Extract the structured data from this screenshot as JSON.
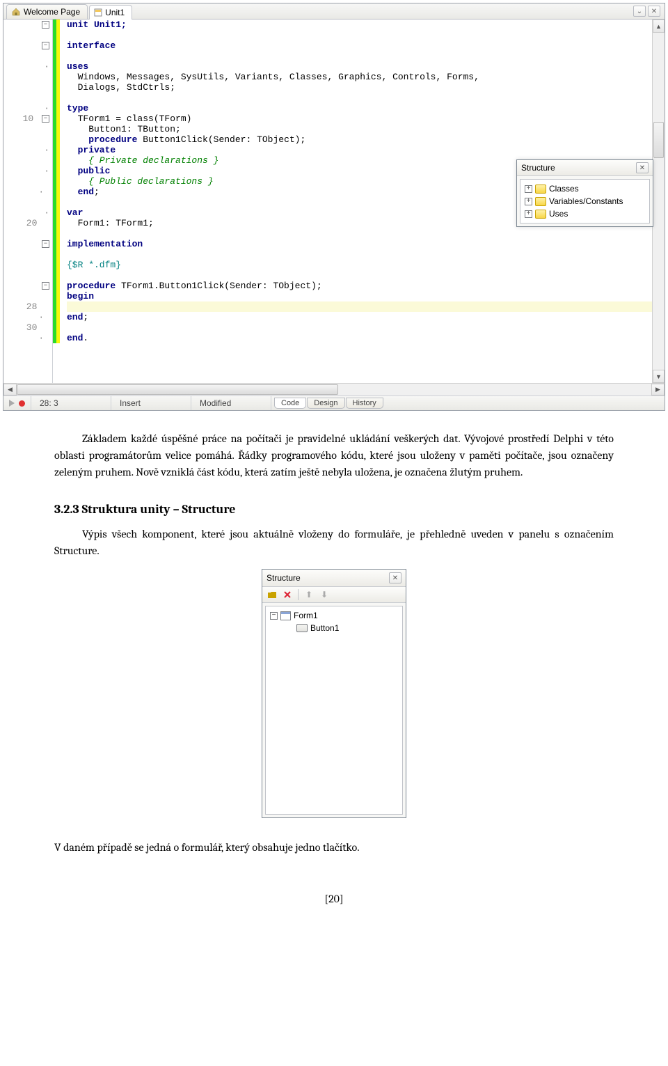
{
  "ide": {
    "tabs": {
      "welcome": "Welcome Page",
      "unit": "Unit1"
    },
    "btns": {
      "chev": "⌄",
      "close": "✕"
    },
    "lineNumbers": {
      "l10": "10",
      "l20": "20",
      "l28": "28",
      "l30": "30"
    },
    "code": {
      "l1": "unit Unit1;",
      "l2": "",
      "l3": "interface",
      "l4": "",
      "l5": "uses",
      "l6": "  Windows, Messages, SysUtils, Variants, Classes, Graphics, Controls, Forms,",
      "l7": "  Dialogs, StdCtrls;",
      "l8": "",
      "l9": "type",
      "l10": "  TForm1 = class(TForm)",
      "l11": "    Button1: TButton;",
      "l12_a": "    ",
      "l12_b": "procedure",
      "l12_c": " Button1Click(Sender: TObject);",
      "l13": "  private",
      "l14": "    { Private declarations }",
      "l15": "  public",
      "l16": "    { Public declarations }",
      "l17_a": "  ",
      "l17_b": "end",
      "l17_c": ";",
      "l18": "",
      "l19": "var",
      "l20": "  Form1: TForm1;",
      "l21": "",
      "l22": "implementation",
      "l23": "",
      "l24": "{$R *.dfm}",
      "l25": "",
      "l26_a": "procedure",
      "l26_b": " TForm1.Button1Click(Sender: TObject);",
      "l27": "begin",
      "l28": "",
      "l29_a": "end",
      "l29_b": ";",
      "l30": "",
      "l31_a": "end",
      "l31_b": "."
    },
    "status": {
      "pos": "28: 3",
      "mode": "Insert",
      "modified": "Modified"
    },
    "viewtabs": {
      "code": "Code",
      "design": "Design",
      "history": "History"
    }
  },
  "structure1": {
    "title": "Structure",
    "close": "✕",
    "items": [
      "Classes",
      "Variables/Constants",
      "Uses"
    ]
  },
  "doc": {
    "p1": "Základem každé úspěšné práce na počítači je pravidelné ukládání veškerých dat. Vývojové prostředí Delphi v této oblasti programátorům velice pomáhá. Řádky programového kódu, které jsou uloženy v paměti počítače, jsou označeny zeleným pruhem. Nově vzniklá část kódu, která zatím ještě nebyla uložena, je označena žlutým pruhem.",
    "h3": "3.2.3    Struktura unity – Structure",
    "p2": "Výpis všech komponent, které jsou aktuálně vloženy do formuláře, je přehledně uveden v panelu s označením Structure.",
    "p3": "V daném případě se jedná o formulář, který obsahuje jedno tlačítko.",
    "pagenum": "[20]"
  },
  "structure2": {
    "title": "Structure",
    "close": "✕",
    "form": "Form1",
    "button": "Button1"
  }
}
